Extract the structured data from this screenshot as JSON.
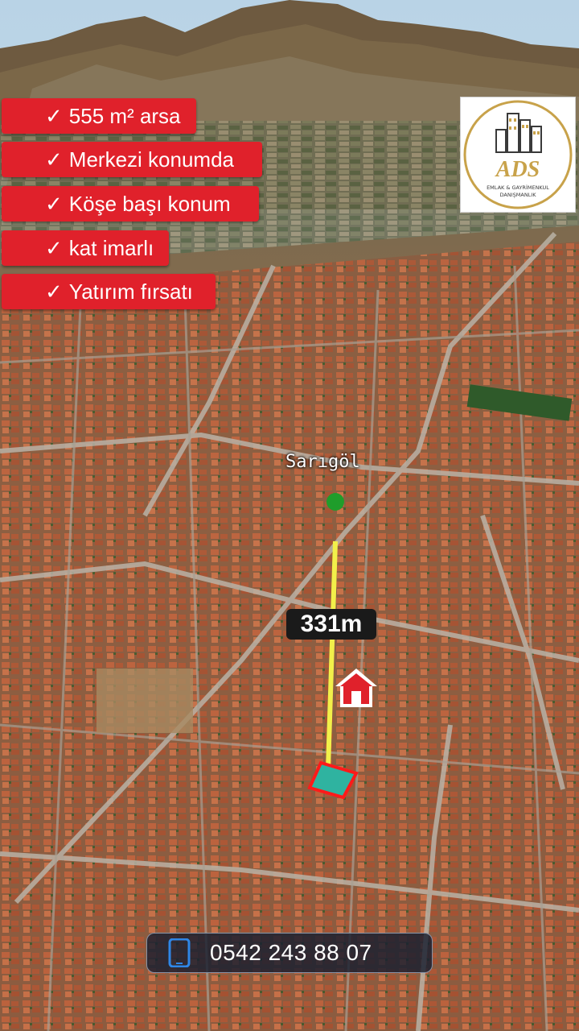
{
  "features": [
    {
      "check": "✓",
      "text": "555 m² arsa"
    },
    {
      "check": "✓",
      "text": "Merkezi konumda"
    },
    {
      "check": "✓",
      "text": "Köşe başı konum"
    },
    {
      "check": "✓",
      "text": "kat imarlı"
    },
    {
      "check": "✓",
      "text": "Yatırım fırsatı"
    }
  ],
  "logo": {
    "brand": "ADS",
    "tagline_1": "EMLAK & GAYRİMENKUL",
    "tagline_2": "DANIŞMANLIK",
    "colors": {
      "gold": "#c8a24a",
      "dark": "#3a3a3a"
    }
  },
  "map": {
    "place_label": "Sarıgöl",
    "distance_label": "331m",
    "icons": [
      "home-icon",
      "location-dot-icon",
      "parcel-outline"
    ],
    "colors": {
      "line": "#f2f04a",
      "parcel_stroke": "#ff1a1a",
      "parcel_fill": "#2fb3a0",
      "dot": "#1f9d2b",
      "home": "#e0212b"
    }
  },
  "contact": {
    "phone": "0542 243 88 07",
    "icon": "phone-icon"
  },
  "colors": {
    "tag_bg": "#e0212b"
  }
}
